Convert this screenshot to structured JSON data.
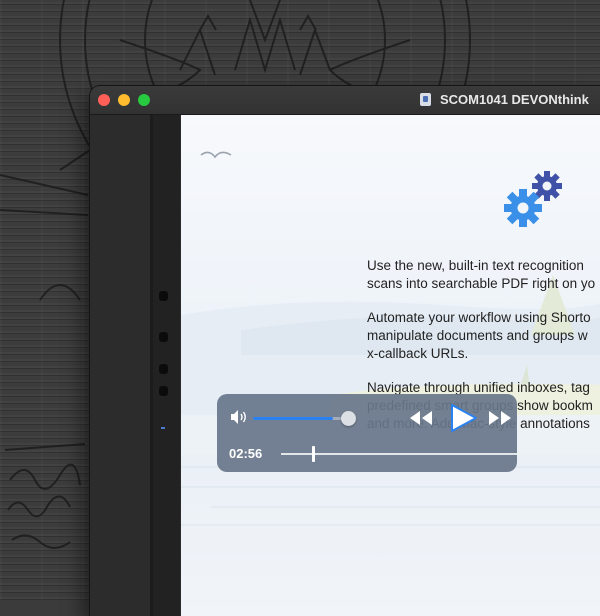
{
  "window": {
    "title": "SCOM1041 DEVONthink"
  },
  "welcome": {
    "paragraphs": [
      "Use the new, built-in text recognition",
      "scans into searchable PDF right on yo",
      "Automate your workflow using Shorto",
      "manipulate documents and groups w",
      "x-callback URLs.",
      "Navigate through unified inboxes, tag",
      "predefined smart groups show bookm",
      "and more. Add Mac-style annotations"
    ]
  },
  "player": {
    "elapsed": "02:56",
    "volume_level": 0.83,
    "playback_position": 0.14
  },
  "icons": {
    "gear": "gear-icon",
    "volume": "volume-icon",
    "rewind": "rewind-icon",
    "play": "play-icon",
    "fast_forward": "fast-forward-icon",
    "next": "arrow-right-circle-icon",
    "bird": "bird-icon"
  },
  "colors": {
    "accent": "#2a82f0",
    "gear_light": "#3a8fe8",
    "gear_dark": "#4052a8",
    "player_bg": "#68768a"
  }
}
